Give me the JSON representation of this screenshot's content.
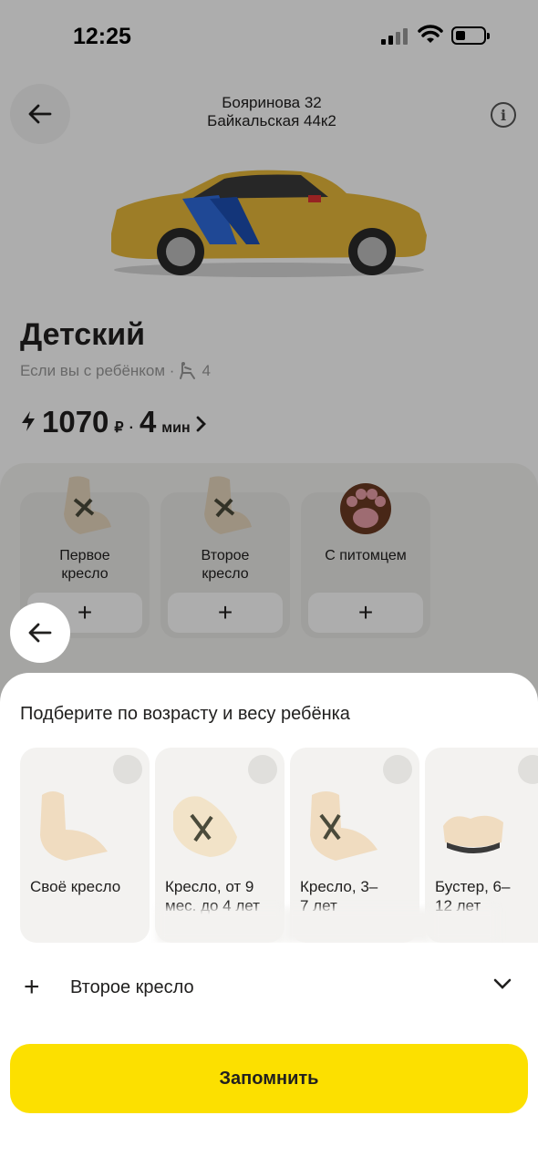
{
  "status_bar": {
    "time": "12:25"
  },
  "header": {
    "route_from": "Бояринова 32",
    "route_to": "Байкальская 44к2",
    "back_icon": "arrow-left-icon",
    "info_icon": "info-icon"
  },
  "tariff": {
    "name": "Детский",
    "subtitle": "Если вы с ребёнком ·",
    "seats": "4",
    "price": "1070",
    "currency": "₽",
    "separator": "·",
    "eta_value": "4",
    "eta_unit": "мин"
  },
  "options": [
    {
      "label_line1": "Первое",
      "label_line2": "кресло",
      "add": "+"
    },
    {
      "label_line1": "Второе",
      "label_line2": "кресло",
      "add": "+"
    },
    {
      "label_line1": "С питомцем",
      "label_line2": "",
      "add": "+"
    }
  ],
  "sheet": {
    "title": "Подберите по возрасту и весу ребёнка",
    "cards": [
      {
        "line1": "Своё кресло",
        "line2": ""
      },
      {
        "line1": "Кресло, от 9",
        "line2": "мес. до 4 лет"
      },
      {
        "line1": "Кресло, 3–",
        "line2": "7 лет"
      },
      {
        "line1": "Бустер, 6–",
        "line2": "12 лет"
      }
    ],
    "second_seat": {
      "plus": "+",
      "label": "Второе кресло"
    },
    "save_label": "Запомнить"
  },
  "colors": {
    "accent": "#fce000",
    "background": "#ffffff",
    "card": "#f3f2f0"
  }
}
